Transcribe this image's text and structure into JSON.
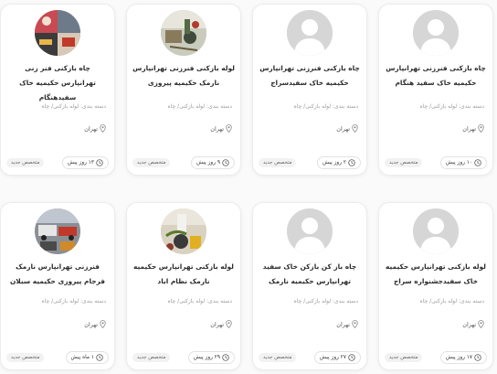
{
  "listings": [
    {
      "title": "چاه بازکنی فنرزنی تهرانپارس حکیمیه خاک سفید هنگام",
      "category": "دسته بندی: لوله بازکنی/ چاه",
      "location": "تهران",
      "time_ago": "۱۰ روز پیش",
      "badge": "متخصص جدید",
      "avatar": "default-avatar"
    },
    {
      "title": "چاه بازکنی فنرزنی تهرانپارس حکیمیه خاک سفیدسراج",
      "category": "دسته بندی: لوله بازکنی/ چاه",
      "location": "تهران",
      "time_ago": "۲ روز پیش",
      "badge": "متخصص جدید",
      "avatar": "default-avatar"
    },
    {
      "title": "لوله بازکنی فنرزنی تهرانپارس نارمک حکیمیه پیروزی",
      "category": "دسته بندی: لوله بازکنی/ چاه",
      "location": "تهران",
      "time_ago": "۹ روز پیش",
      "badge": "متخصص جدید",
      "avatar": "photo-tools"
    },
    {
      "title": "چاه بازکنی فنر زنی تهرانپارس حکیمیه خاک سفیدهنگام",
      "category": "دسته بندی: لوله بازکنی/ چاه",
      "location": "تهران",
      "time_ago": "۱۳ روز پیش",
      "badge": "متخصص جدید",
      "avatar": "photo-collage"
    },
    {
      "title": "لوله بازکنی تهرانپارس حکیمیه خاک سفیدجشنواره سراج",
      "category": "دسته بندی: لوله بازکنی/ چاه",
      "location": "تهران",
      "time_ago": "۱۷ روز پیش",
      "badge": "متخصص جدید",
      "avatar": "default-avatar"
    },
    {
      "title": "چاه باز کن بازکن خاک سفید تهرانپارس حکیمیه نارمک",
      "category": "دسته بندی: لوله بازکنی/ چاه",
      "location": "تهران",
      "time_ago": "۲۷ روز پیش",
      "badge": "متخصص جدید",
      "avatar": "default-avatar"
    },
    {
      "title": "لوله بازکنی تهرانپارس حکیمیه نارمک نظام اباد",
      "category": "دسته بندی: لوله بازکنی/ چاه",
      "location": "تهران",
      "time_ago": "۲۹ روز پیش",
      "badge": "متخصص جدید",
      "avatar": "photo-pipe"
    },
    {
      "title": "فنرزنی تهرانپارس نارمک فرجام پیروزی حکیمیه سبلان",
      "category": "دسته بندی: لوله بازکنی/ چاه",
      "location": "تهران",
      "time_ago": "۱ ماه پیش",
      "badge": "متخصص جدید",
      "avatar": "photo-vehicles"
    }
  ]
}
